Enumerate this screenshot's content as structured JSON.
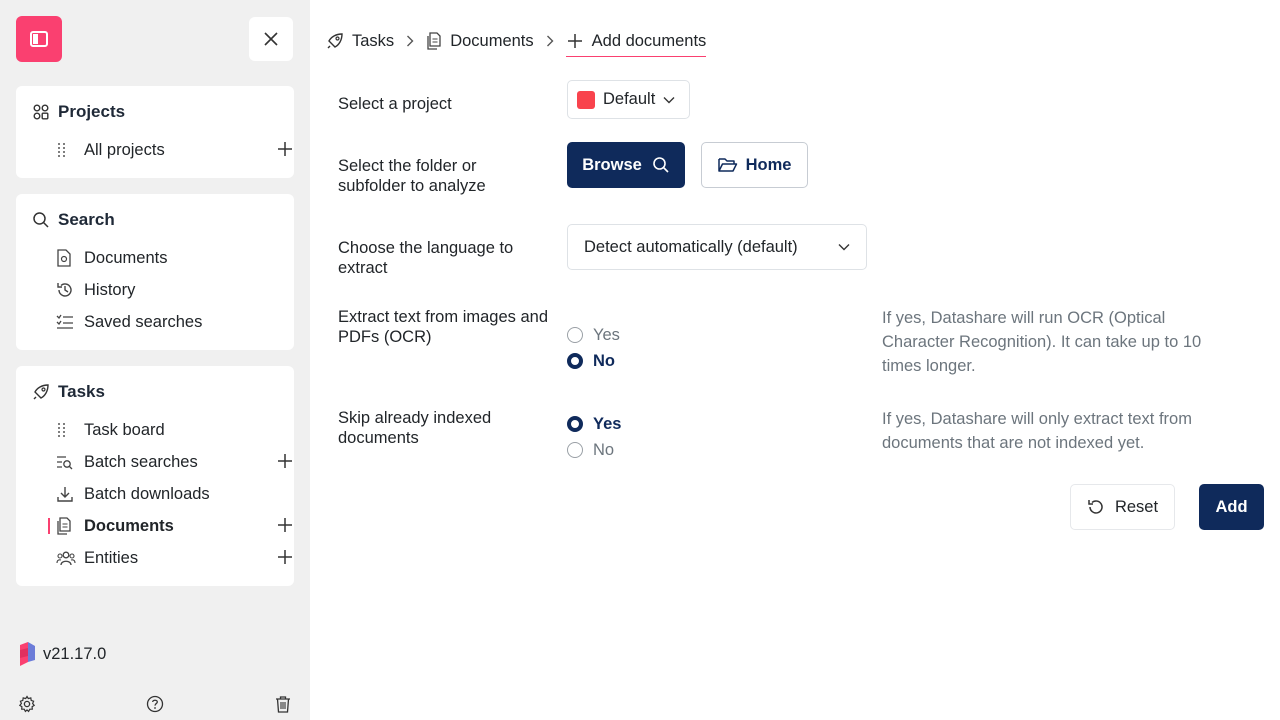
{
  "sidebar": {
    "logo_icon": "sidebar-toggle-icon",
    "close_icon": "close-icon",
    "projects": {
      "title": "Projects",
      "items": [
        {
          "label": "All projects",
          "icon": "grid-dots-icon"
        }
      ]
    },
    "search": {
      "title": "Search",
      "items": [
        {
          "label": "Documents",
          "icon": "document-search-icon"
        },
        {
          "label": "History",
          "icon": "history-icon"
        },
        {
          "label": "Saved searches",
          "icon": "list-check-icon"
        }
      ]
    },
    "tasks": {
      "title": "Tasks",
      "items": [
        {
          "label": "Task board",
          "icon": "grid-dots-icon"
        },
        {
          "label": "Batch searches",
          "icon": "batch-search-icon"
        },
        {
          "label": "Batch downloads",
          "icon": "download-icon"
        },
        {
          "label": "Documents",
          "icon": "documents-icon"
        },
        {
          "label": "Entities",
          "icon": "users-icon"
        }
      ]
    },
    "version": "v21.17.0"
  },
  "breadcrumb": {
    "items": [
      {
        "label": "Tasks",
        "icon": "rocket-icon"
      },
      {
        "label": "Documents",
        "icon": "documents-icon"
      },
      {
        "label": "Add documents",
        "icon": "plus-icon"
      }
    ]
  },
  "form": {
    "project": {
      "label": "Select a project",
      "value": "Default",
      "color": "#f9434d"
    },
    "folder": {
      "label": "Select the folder or subfolder to analyze",
      "browse_label": "Browse",
      "home_label": "Home"
    },
    "language": {
      "label": "Choose the language to extract",
      "value": "Detect automatically (default)"
    },
    "ocr": {
      "label": "Extract text from images and PDFs (OCR)",
      "options": [
        "Yes",
        "No"
      ],
      "selected": "No",
      "help": "If yes, Datashare will run OCR (Optical Character Recognition). It can take up to 10 times longer."
    },
    "skip": {
      "label": "Skip already indexed documents",
      "options": [
        "Yes",
        "No"
      ],
      "selected": "Yes",
      "help": "If yes, Datashare will only extract text from documents that are not indexed yet."
    },
    "reset_label": "Reset",
    "add_label": "Add"
  },
  "colors": {
    "accent": "#fa4070",
    "primary": "#0f2a5b",
    "sidebar_bg": "#f0f0f0"
  }
}
